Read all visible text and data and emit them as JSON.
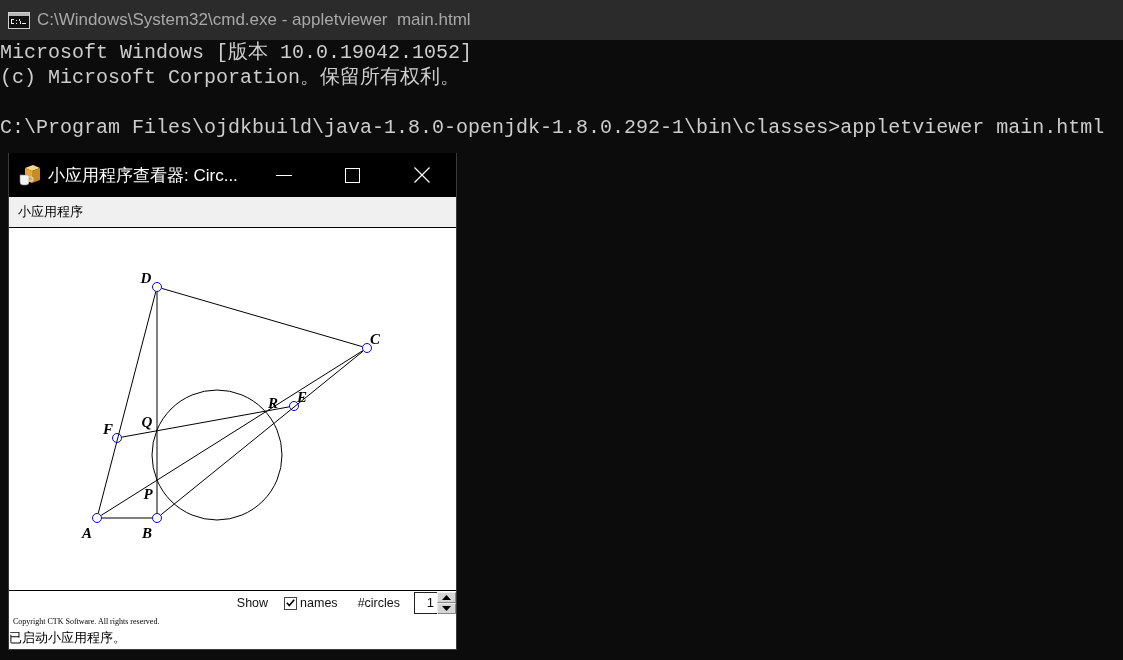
{
  "console": {
    "title": "C:\\Windows\\System32\\cmd.exe - appletviewer  main.html",
    "blocks": [
      [
        "Microsoft Windows [版本 10.0.19042.1052]",
        "(c) Microsoft Corporation。保留所有权利。"
      ],
      [
        "C:\\Program Files\\ojdkbuild\\java-1.8.0-openjdk-1.8.0.292-1\\bin\\classes>appletviewer main.html"
      ]
    ]
  },
  "applet_window": {
    "title": "小应用程序查看器: Circ...",
    "menu": [
      "小应用程序"
    ],
    "diagram": {
      "points": [
        {
          "label": "D",
          "kind": "free"
        },
        {
          "label": "C",
          "kind": "free"
        },
        {
          "label": "E",
          "kind": "free"
        },
        {
          "label": "R",
          "kind": "intersection"
        },
        {
          "label": "F",
          "kind": "free"
        },
        {
          "label": "Q",
          "kind": "intersection"
        },
        {
          "label": "P",
          "kind": "intersection"
        },
        {
          "label": "A",
          "kind": "free"
        },
        {
          "label": "B",
          "kind": "free"
        }
      ]
    },
    "controls": {
      "show_label": "Show",
      "names_checkbox": {
        "label": "names",
        "checked": true
      },
      "circles_label": "#circles",
      "circles_value": "1"
    },
    "copyright": "Copyright CTK Software. All rights reserved.",
    "status": "已启动小应用程序。"
  }
}
